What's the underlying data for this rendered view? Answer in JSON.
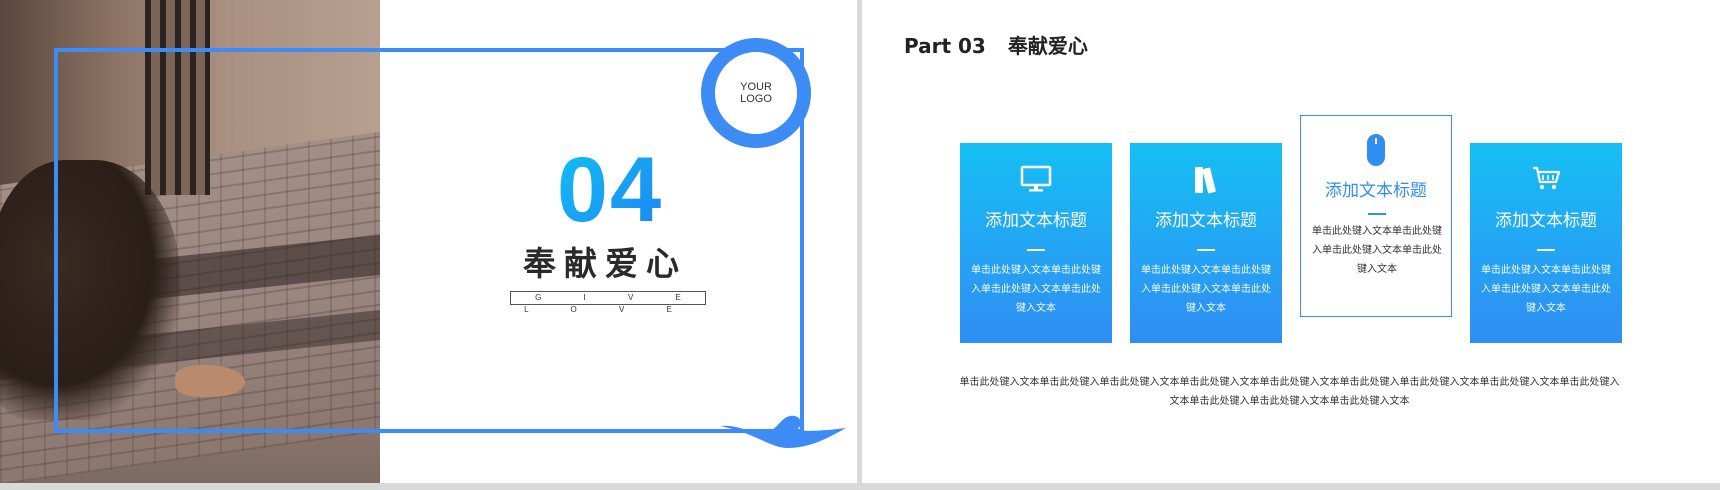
{
  "left_slide": {
    "logo": {
      "line1": "YOUR",
      "line2": "LOGO"
    },
    "section_number": "04",
    "title": "奉献爱心",
    "subtitle": "G I V E  L O V E"
  },
  "right_slide": {
    "part_label": "Part 03",
    "part_title": "奉献爱心",
    "cards": [
      {
        "icon": "monitor-icon",
        "title": "添加文本标题",
        "body": "单击此处键入文本单击此处键入单击此处键入文本单击此处键入文本",
        "style": "filled"
      },
      {
        "icon": "books-icon",
        "title": "添加文本标题",
        "body": "单击此处键入文本单击此处键入单击此处键入文本单击此处键入文本",
        "style": "filled"
      },
      {
        "icon": "mouse-icon",
        "title": "添加文本标题",
        "body": "单击此处键入文本单击此处键入单击此处键入文本单击此处键入文本",
        "style": "outlined"
      },
      {
        "icon": "cart-icon",
        "title": "添加文本标题",
        "body": "单击此处键入文本单击此处键入单击此处键入文本单击此处键入文本",
        "style": "filled"
      }
    ],
    "footer_text": "单击此处键入文本单击此处键入单击此处键入文本单击此处键入文本单击此处键入文本单击此处键入单击此处键入文本单击此处键入文本单击此处键入文本单击此处键入单击此处键入文本单击此处键入文本"
  },
  "colors": {
    "accent": "#3d8bf5",
    "gradient_start": "#16bff4",
    "gradient_end": "#2f8ef3"
  }
}
